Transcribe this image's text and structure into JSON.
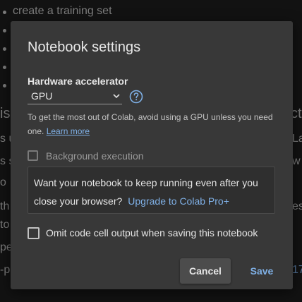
{
  "background": {
    "lines": [
      {
        "text": "create a training set"
      },
      {
        "text": "isi"
      },
      {
        "text": "s u"
      },
      {
        "text": "s s"
      },
      {
        "text": "o"
      },
      {
        "text": "th"
      },
      {
        "text": "to"
      },
      {
        "text": "pe"
      },
      {
        "text": "-p"
      }
    ],
    "right_fragments": [
      "ct",
      "La",
      "w",
      "est",
      "17"
    ]
  },
  "dialog": {
    "title": "Notebook settings",
    "hardware_accelerator": {
      "label": "Hardware accelerator",
      "selected": "GPU",
      "hint": "To get the most out of Colab, avoid using a GPU unless you need one.",
      "learn_more": "Learn more"
    },
    "background_execution": {
      "label": "Background execution",
      "checked": false,
      "disabled": true
    },
    "promo": {
      "text": "Want your notebook to keep running even after you close your browser?",
      "link": "Upgrade to Colab Pro+"
    },
    "omit_output": {
      "label": "Omit code cell output when saving this notebook",
      "checked": false
    },
    "buttons": {
      "cancel": "Cancel",
      "save": "Save"
    }
  },
  "colors": {
    "dialog_bg": "#383838",
    "link": "#7fb0e6",
    "cancel_bg": "#4c4c4c"
  },
  "icons": {
    "select_chevron": "chevron-down-icon",
    "help": "help-circle-icon"
  }
}
